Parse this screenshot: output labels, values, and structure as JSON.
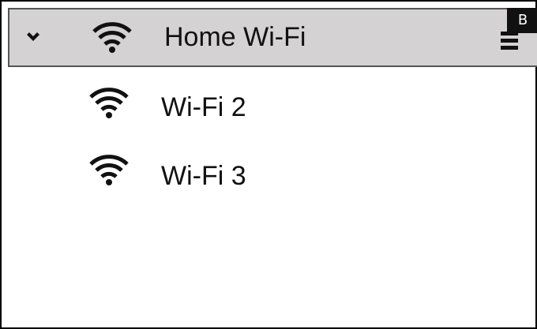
{
  "networks": [
    {
      "name": "Home Wi-Fi",
      "selected": true,
      "icon": "wifi-icon"
    },
    {
      "name": "Wi-Fi 2",
      "selected": false,
      "icon": "wifi-icon"
    },
    {
      "name": "Wi-Fi 3",
      "selected": false,
      "icon": "wifi-icon"
    }
  ],
  "header": {
    "expand_icon": "chevron-down-icon",
    "menu_icon": "menu-icon",
    "badge_label": "B"
  },
  "colors": {
    "selected_background": "#d4d2d2",
    "text": "#111111",
    "badge_background": "#111111"
  }
}
